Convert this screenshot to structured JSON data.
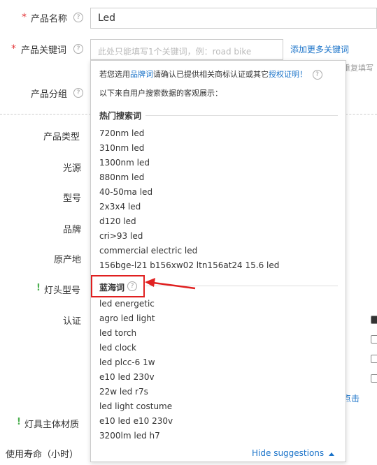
{
  "form": {
    "name_label": "产品名称",
    "name_value": "Led",
    "keyword_label": "产品关键词",
    "keyword_placeholder": "此处只能填写1个关键词，例：road bike",
    "add_more_keywords": "添加更多关键词",
    "repeat_fill_hint": "重复填写",
    "group_label": "产品分组",
    "fields": [
      "产品类型",
      "光源",
      "型号",
      "品牌",
      "原产地",
      "灯头型号",
      "认证"
    ],
    "body_material_label": "灯具主体材质",
    "lifespan_label": "使用寿命（小时）",
    "click_link": "点击"
  },
  "dropdown": {
    "notice_prefix": "若您选用",
    "notice_brand": "品牌词",
    "notice_middle": "请确认已提供相关商标认证或其它",
    "notice_auth": "授权证明！",
    "notice_sub": "以下来自用户搜索数据的客观展示：",
    "hot_title": "热门搜索词",
    "hot_terms": [
      "720nm led",
      "310nm led",
      "1300nm led",
      "880nm led",
      "40-50ma led",
      "2x3x4 led",
      "d120 led",
      "cri>93 led",
      "commercial electric led",
      "156bge-l21 b156xw02 ltn156at24 15.6 led"
    ],
    "blue_title": "蓝海词",
    "blue_terms": [
      "led energetic",
      "agro led light",
      "led torch",
      "led clock",
      "led plcc-6 1w",
      "e10 led 230v",
      "22w led r7s",
      "led light costume",
      "e10 led e10 230v",
      "3200lm led h7"
    ],
    "hide_label": "Hide suggestions",
    "help_glyph": "?",
    "required_mark": "*",
    "warn_mark": "!"
  },
  "colors": {
    "link": "#1a73c9",
    "required": "#e4393c",
    "annotation": "#e02020"
  }
}
